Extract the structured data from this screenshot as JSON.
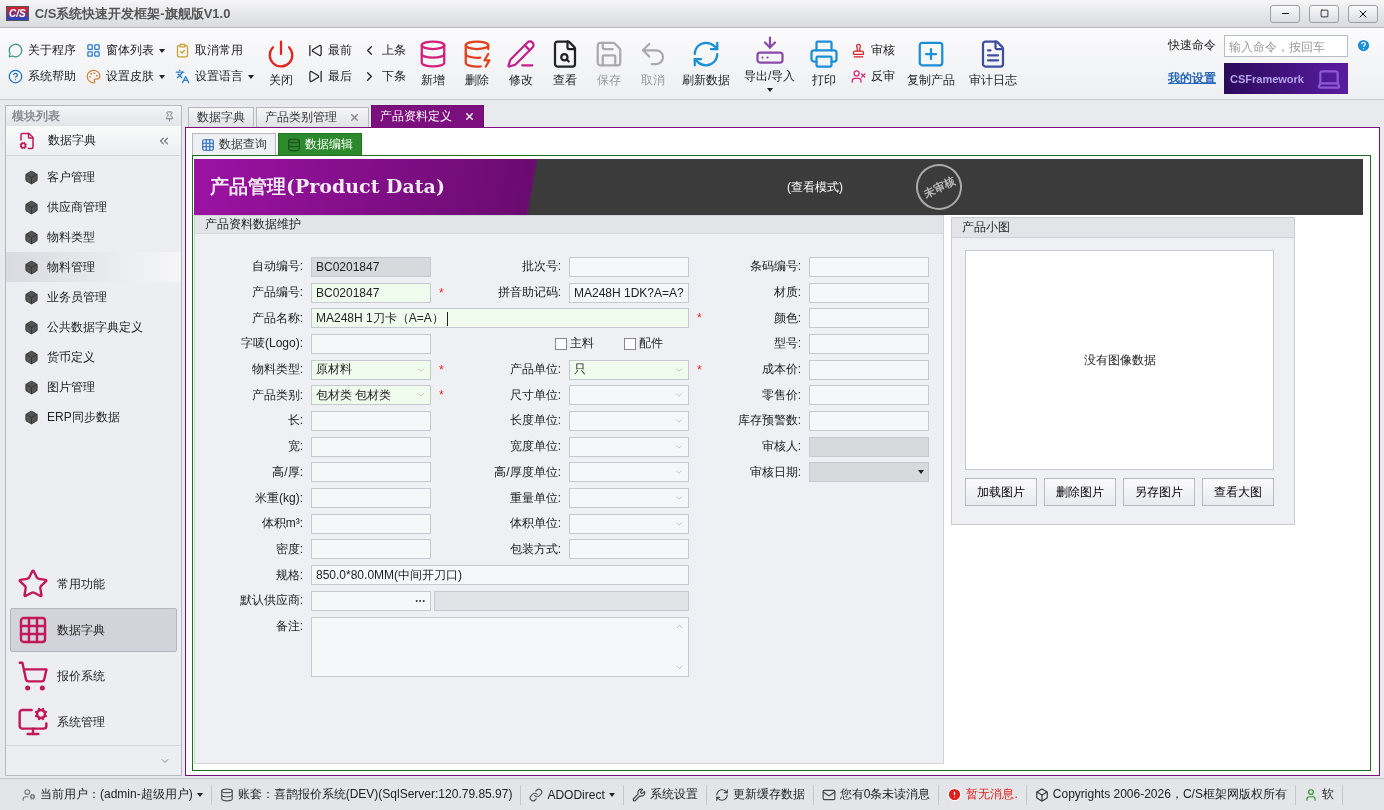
{
  "window": {
    "logo": "C/S",
    "title": "C/S系统快速开发框架-旗舰版V1.0"
  },
  "toolbar": {
    "items": [
      {
        "kind": "stack",
        "items": [
          {
            "label": "关于程序",
            "dropdown": false
          },
          {
            "label": "系统帮助",
            "dropdown": false
          }
        ]
      },
      {
        "kind": "stack",
        "items": [
          {
            "label": "窗体列表",
            "dropdown": true
          },
          {
            "label": "设置皮肤",
            "dropdown": true
          }
        ]
      },
      {
        "kind": "stack",
        "items": [
          {
            "label": "取消常用",
            "dropdown": false
          },
          {
            "label": "设置语言",
            "dropdown": true
          }
        ]
      },
      {
        "kind": "big",
        "label": "关闭",
        "disabled": false,
        "dropdown": false
      },
      {
        "kind": "stack",
        "items": [
          {
            "label": "最前",
            "dropdown": false
          },
          {
            "label": "最后",
            "dropdown": false
          }
        ]
      },
      {
        "kind": "stack",
        "items": [
          {
            "label": "上条",
            "dropdown": false
          },
          {
            "label": "下条",
            "dropdown": false
          }
        ]
      },
      {
        "kind": "big",
        "label": "新增",
        "disabled": false,
        "dropdown": false
      },
      {
        "kind": "big",
        "label": "删除",
        "disabled": false,
        "dropdown": false
      },
      {
        "kind": "big",
        "label": "修改",
        "disabled": false,
        "dropdown": false
      },
      {
        "kind": "big",
        "label": "查看",
        "disabled": false,
        "dropdown": false
      },
      {
        "kind": "big",
        "label": "保存",
        "disabled": true,
        "dropdown": false
      },
      {
        "kind": "big",
        "label": "取消",
        "disabled": true,
        "dropdown": false
      },
      {
        "kind": "big",
        "label": "刷新数据",
        "disabled": false,
        "dropdown": false
      },
      {
        "kind": "big",
        "label": "导出/导入",
        "disabled": false,
        "dropdown": true
      },
      {
        "kind": "big",
        "label": "打印",
        "disabled": false,
        "dropdown": false
      },
      {
        "kind": "stack",
        "items": [
          {
            "label": "审核",
            "dropdown": false
          },
          {
            "label": "反审",
            "dropdown": false
          }
        ]
      },
      {
        "kind": "big",
        "label": "复制产品",
        "disabled": false,
        "dropdown": false
      },
      {
        "kind": "big",
        "label": "审计日志",
        "disabled": false,
        "dropdown": false
      }
    ],
    "quick": {
      "label": "快速命令",
      "placeholder": "输入命令，按回车",
      "link": "我的设置",
      "brand": "CSFramework"
    }
  },
  "sidebar": {
    "title": "模块列表",
    "header": "数据字典",
    "items": [
      {
        "label": "客户管理",
        "selected": false
      },
      {
        "label": "供应商管理",
        "selected": false
      },
      {
        "label": "物料类型",
        "selected": false
      },
      {
        "label": "物料管理",
        "selected": true
      },
      {
        "label": "业务员管理",
        "selected": false
      },
      {
        "label": "公共数据字典定义",
        "selected": false
      },
      {
        "label": "货币定义",
        "selected": false
      },
      {
        "label": "图片管理",
        "selected": false
      },
      {
        "label": "ERP同步数据",
        "selected": false
      }
    ],
    "groups": [
      {
        "label": "常用功能",
        "selected": false
      },
      {
        "label": "数据字典",
        "selected": true
      },
      {
        "label": "报价系统",
        "selected": false
      },
      {
        "label": "系统管理",
        "selected": false
      }
    ]
  },
  "doc_tabs": [
    {
      "label": "数据字典",
      "selected": false,
      "closable": false
    },
    {
      "label": "产品类别管理",
      "selected": false,
      "closable": true
    },
    {
      "label": "产品资料定义",
      "selected": true,
      "closable": true
    }
  ],
  "sub_tabs": [
    {
      "label": "数据查询",
      "selected": false
    },
    {
      "label": "数据编辑",
      "selected": true
    }
  ],
  "banner": {
    "title": "产品管理(Product Data)",
    "mode": "(查看模式)",
    "stamp": "未审核"
  },
  "form": {
    "title": "产品资料数据维护",
    "required_mark": "*",
    "rows": [
      {
        "left": {
          "label": "自动编号:",
          "kind": "text",
          "value": "BC0201847",
          "readonly": true,
          "required": false
        },
        "middle": {
          "label": "批次号:",
          "kind": "text",
          "readonly": false,
          "required": false
        },
        "right": {
          "label": "条码编号:",
          "kind": "text",
          "readonly": false,
          "required": false
        }
      },
      {
        "left": {
          "label": "产品编号:",
          "kind": "text",
          "value": "BC0201847",
          "readonly": false,
          "required": true
        },
        "middle": {
          "label": "拼音助记码:",
          "kind": "text",
          "value": "MA248H  1DK?A=A?",
          "readonly": false,
          "required": false
        },
        "right": {
          "label": "材质:",
          "kind": "text",
          "readonly": false,
          "required": false
        }
      },
      {
        "left": {
          "label": "产品名称:",
          "kind": "text",
          "value": "MA248H  1刀卡（A=A）",
          "readonly": false,
          "required": true,
          "wide": true,
          "focused": true
        },
        "right": {
          "label": "颜色:",
          "kind": "text",
          "readonly": false,
          "required": false
        }
      },
      {
        "left": {
          "label": "字唛(Logo):",
          "kind": "text",
          "readonly": false,
          "required": false
        },
        "middle": {
          "kind": "checks",
          "options": [
            {
              "label": "主料",
              "checked": false
            },
            {
              "label": "配件",
              "checked": false
            }
          ]
        },
        "right": {
          "label": "型号:",
          "kind": "text",
          "readonly": false,
          "required": false
        }
      },
      {
        "left": {
          "label": "物料类型:",
          "kind": "combo",
          "value": "原材料",
          "readonly": false,
          "required": true
        },
        "middle": {
          "label": "产品单位:",
          "kind": "combo",
          "value": "只",
          "readonly": false,
          "required": true
        },
        "right": {
          "label": "成本价:",
          "kind": "text",
          "readonly": false,
          "required": false
        }
      },
      {
        "left": {
          "label": "产品类别:",
          "kind": "combo",
          "value": "包材类 包材类",
          "readonly": false,
          "required": true
        },
        "middle": {
          "label": "尺寸单位:",
          "kind": "combo",
          "readonly": false,
          "required": false
        },
        "right": {
          "label": "零售价:",
          "kind": "text",
          "readonly": false,
          "required": false
        }
      },
      {
        "left": {
          "label": "长:",
          "kind": "text",
          "readonly": false,
          "required": false
        },
        "middle": {
          "label": "长度单位:",
          "kind": "combo",
          "readonly": false,
          "required": false
        },
        "right": {
          "label": "库存预警数:",
          "kind": "text",
          "readonly": false,
          "required": false
        }
      },
      {
        "left": {
          "label": "宽:",
          "kind": "text",
          "readonly": false,
          "required": false
        },
        "middle": {
          "label": "宽度单位:",
          "kind": "combo",
          "readonly": false,
          "required": false
        },
        "right": {
          "label": "审核人:",
          "kind": "text",
          "readonly": true,
          "required": false
        }
      },
      {
        "left": {
          "label": "高/厚:",
          "kind": "text",
          "readonly": false,
          "required": false
        },
        "middle": {
          "label": "高/厚度单位:",
          "kind": "combo",
          "readonly": false,
          "required": false
        },
        "right": {
          "label": "审核日期:",
          "kind": "date",
          "readonly": true,
          "required": false
        }
      },
      {
        "left": {
          "label": "米重(kg):",
          "kind": "text",
          "readonly": false,
          "required": false
        },
        "middle": {
          "label": "重量单位:",
          "kind": "combo",
          "readonly": false,
          "required": false
        }
      },
      {
        "left": {
          "label": "体积m³:",
          "kind": "text",
          "readonly": false,
          "required": false
        },
        "middle": {
          "label": "体积单位:",
          "kind": "combo",
          "readonly": false,
          "required": false
        }
      },
      {
        "left": {
          "label": "密度:",
          "kind": "text",
          "readonly": false,
          "required": false
        },
        "middle": {
          "label": "包装方式:",
          "kind": "text",
          "readonly": false,
          "required": false
        }
      },
      {
        "left": {
          "label": "规格:",
          "kind": "text",
          "value": "850.0*80.0MM(中间开刀口)",
          "readonly": false,
          "required": false,
          "wide": true
        }
      },
      {
        "left": {
          "label": "默认供应商:",
          "kind": "lookup",
          "readonly": false,
          "required": false,
          "wide": true
        }
      },
      {
        "left": {
          "label": "备注:",
          "kind": "memo",
          "readonly": false,
          "required": false,
          "wide": true
        }
      }
    ]
  },
  "picture_panel": {
    "title": "产品小图",
    "empty_text": "没有图像数据",
    "buttons": [
      "加载图片",
      "删除图片",
      "另存图片",
      "查看大图"
    ]
  },
  "status_bar": [
    {
      "label": "当前用户：(admin-超级用户)",
      "dropdown": true
    },
    {
      "label": "账套：喜鹊报价系统(DEV)(SqlServer:120.79.85.97)",
      "dropdown": false
    },
    {
      "label": "ADODirect",
      "dropdown": true
    },
    {
      "label": "系统设置",
      "dropdown": false
    },
    {
      "label": "更新缓存数据",
      "dropdown": false
    },
    {
      "label": "您有0条未读消息",
      "dropdown": false
    },
    {
      "label": "暂无消息.",
      "dropdown": false,
      "color": "#e0201c"
    },
    {
      "label": "Copyrights 2006-2026，C/S框架网版权所有",
      "dropdown": false
    },
    {
      "label": "软",
      "dropdown": false
    }
  ]
}
